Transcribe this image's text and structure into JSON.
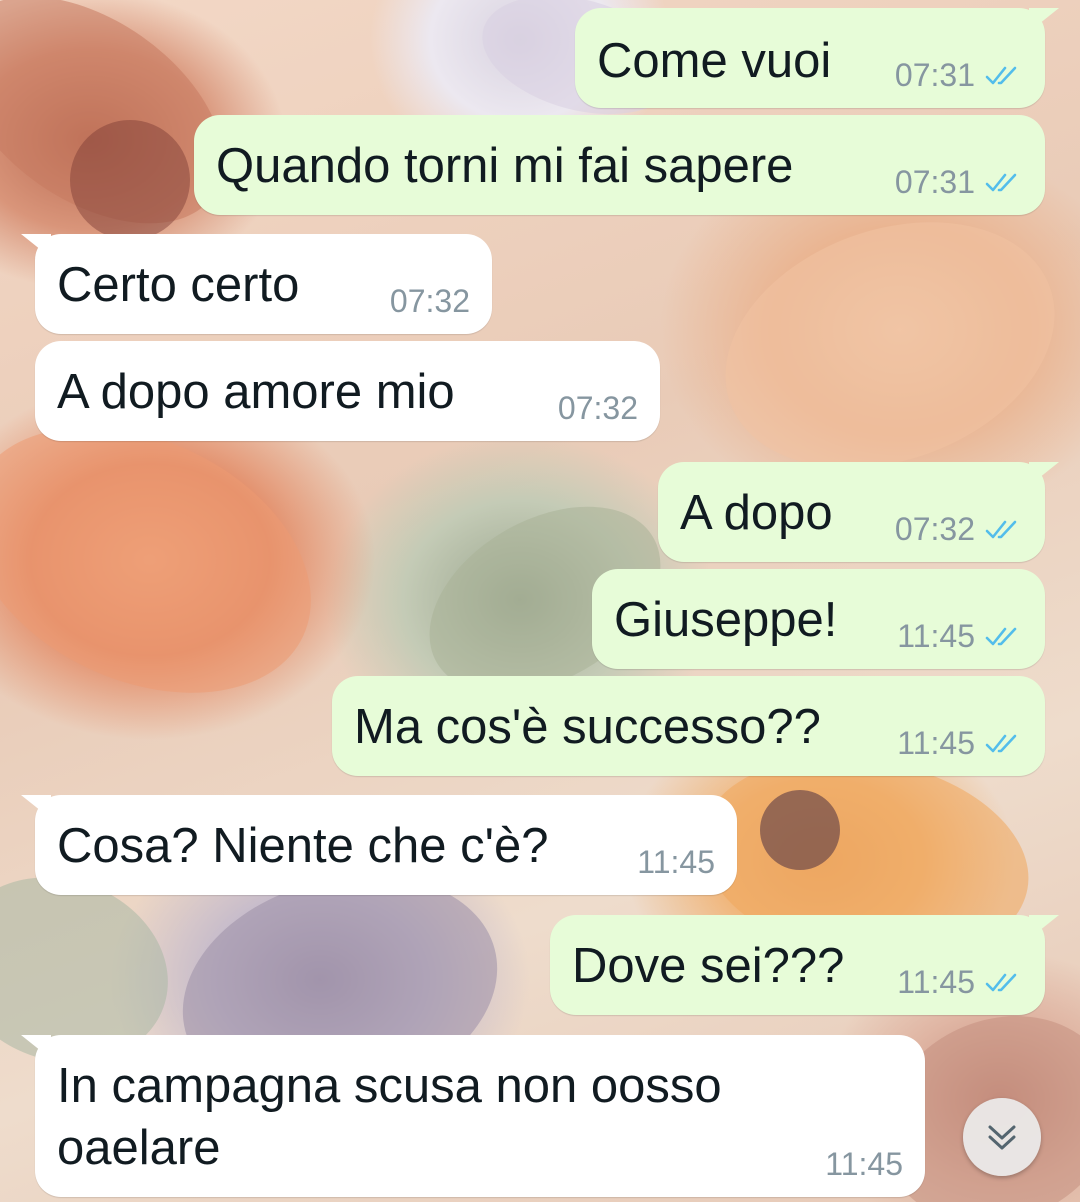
{
  "colors": {
    "outgoing_bubble": "#e7fcd8",
    "incoming_bubble": "#ffffff",
    "read_ticks": "#53bdeb",
    "timestamp": "#8696a0"
  },
  "messages": [
    {
      "direction": "out",
      "text": "Come vuoi",
      "time": "07:31",
      "status": "read"
    },
    {
      "direction": "out",
      "text": "Quando torni mi fai sapere",
      "time": "07:31",
      "status": "read"
    },
    {
      "direction": "in",
      "text": "Certo certo",
      "time": "07:32"
    },
    {
      "direction": "in",
      "text": "A dopo amore mio",
      "time": "07:32"
    },
    {
      "direction": "out",
      "text": "A dopo",
      "time": "07:32",
      "status": "read"
    },
    {
      "direction": "out",
      "text": "Giuseppe!",
      "time": "11:45",
      "status": "read"
    },
    {
      "direction": "out",
      "text": "Ma cos'è successo??",
      "time": "11:45",
      "status": "read"
    },
    {
      "direction": "in",
      "text": "Cosa? Niente che c'è?",
      "time": "11:45"
    },
    {
      "direction": "out",
      "text": "Dove sei???",
      "time": "11:45",
      "status": "read"
    },
    {
      "direction": "in",
      "text": "In campagna scusa non oosso\noaelare",
      "time": "11:45"
    }
  ],
  "scroll_button": {
    "icon": "double-chevron-down-icon"
  }
}
